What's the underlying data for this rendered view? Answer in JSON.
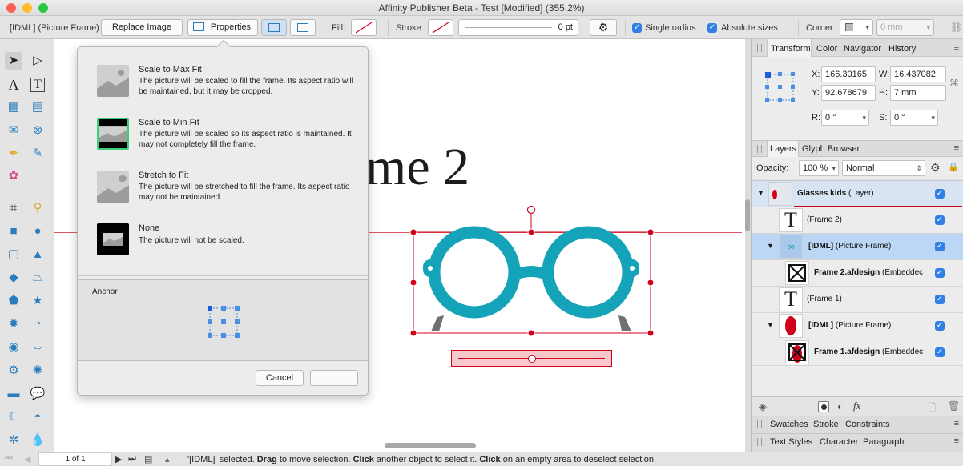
{
  "window": {
    "title": "Affinity Publisher Beta - Test [Modified] (355.2%)"
  },
  "context_toolbar": {
    "selection_label": "[IDML] (Picture Frame)",
    "replace_image": "Replace Image",
    "properties": "Properties",
    "fill_label": "Fill:",
    "stroke_label": "Stroke",
    "stroke_width": "0 pt",
    "single_radius": "Single radius",
    "absolute_sizes": "Absolute sizes",
    "corner_label": "Corner:",
    "corner_value": "0 mm"
  },
  "popover": {
    "options": [
      {
        "title": "Scale to Max Fit",
        "desc": "The picture will be scaled to fill the frame. Its aspect ratio will be maintained, but it may be cropped."
      },
      {
        "title": "Scale to Min Fit",
        "desc": "The picture will be scaled so its aspect ratio is maintained. It may not completely fill the frame."
      },
      {
        "title": "Stretch to Fit",
        "desc": "The picture will be stretched to fill the frame. Its aspect ratio may not be maintained."
      },
      {
        "title": "None",
        "desc": "The picture will not be scaled."
      }
    ],
    "anchor_label": "Anchor",
    "cancel": "Cancel",
    "ok": ""
  },
  "canvas": {
    "heading_fragment": "me 2"
  },
  "right_panel": {
    "tabs": [
      "Transform",
      "Color",
      "Navigator",
      "History"
    ],
    "transform": {
      "x_label": "X:",
      "x": "166.30165",
      "y_label": "Y:",
      "y": "92.678679",
      "w_label": "W:",
      "w": "16.437082",
      "h_label": "H:",
      "h": "7 mm",
      "r_label": "R:",
      "r": "0 °",
      "s_label": "S:",
      "s": "0 °"
    },
    "layer_tabs": [
      "Layers",
      "Glyph Browser"
    ],
    "opacity_label": "Opacity:",
    "opacity": "100 %",
    "blend_mode": "Normal",
    "layers": [
      {
        "name": "Glasses kids",
        "suffix": "(Layer)",
        "bold": true
      },
      {
        "name": "",
        "suffix": "(Frame 2)",
        "bold": false
      },
      {
        "name": "[IDML]",
        "suffix": "(Picture Frame)",
        "bold": true
      },
      {
        "name": "Frame 2.afdesign",
        "suffix": "(Embeddec",
        "bold": true
      },
      {
        "name": "",
        "suffix": "(Frame 1)",
        "bold": false
      },
      {
        "name": "[IDML]",
        "suffix": "(Picture Frame)",
        "bold": true
      },
      {
        "name": "Frame 1.afdesign",
        "suffix": "(Embeddec",
        "bold": true
      }
    ],
    "bottom_tabs_1": [
      "Swatches",
      "Stroke",
      "Constraints"
    ],
    "bottom_tabs_2": [
      "Text Styles",
      "Character",
      "Paragraph"
    ]
  },
  "status": {
    "page": "1 of 1",
    "message_pre": "'[IDML]' selected. ",
    "drag": "Drag",
    "message_mid1": " to move selection. ",
    "click": "Click",
    "message_mid2": " another object to select it. ",
    "click2": "Click",
    "message_end": " on an empty area to deselect selection."
  },
  "colors": {
    "accent": "#2f7fe5",
    "glasses": "#14a3b8",
    "selection": "#d0021b"
  }
}
